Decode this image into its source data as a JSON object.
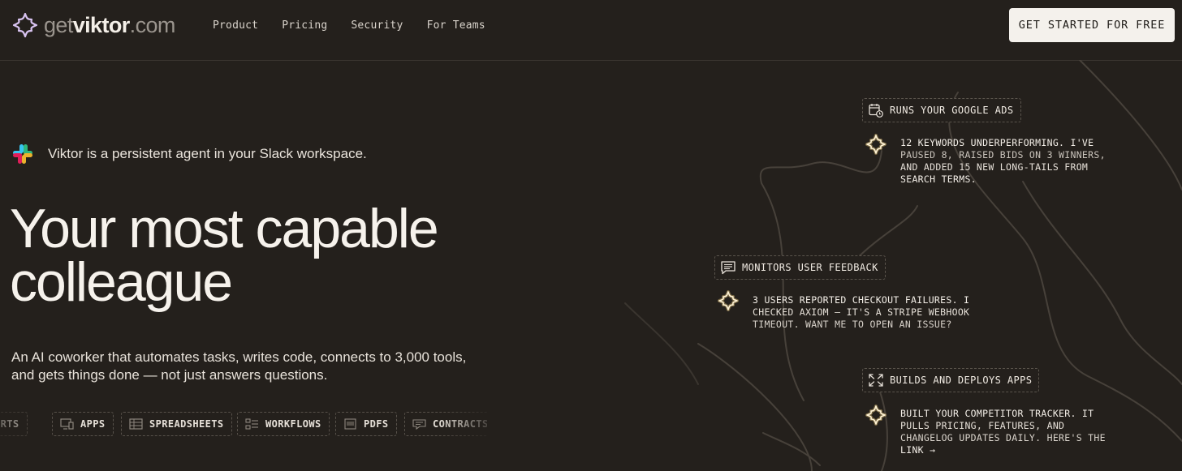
{
  "nav": {
    "logo_prefix": "get",
    "logo_name": "viktor",
    "logo_suffix": ".com",
    "links": [
      "Product",
      "Pricing",
      "Security",
      "For Teams"
    ],
    "cta": "GET STARTED FOR FREE"
  },
  "hero": {
    "slack_line": "Viktor is a persistent agent in your Slack workspace.",
    "headline_lines": [
      "Your most capable",
      "colleague"
    ],
    "sub_lines": [
      "An AI coworker that automates tasks, writes code, connects to 3,000 tools,",
      "and gets things done — not just answers questions."
    ],
    "chips": [
      "ORTS",
      "APPS",
      "SPREADSHEETS",
      "WORKFLOWS",
      "PDFS",
      "CONTRACTS"
    ]
  },
  "cards": [
    {
      "tag": "RUNS YOUR GOOGLE ADS",
      "icon": "calendar-clock-icon",
      "message_lines": [
        "12 KEYWORDS UNDERPERFORMING. I'VE",
        "PAUSED 8, RAISED BIDS ON 3 WINNERS,",
        "AND ADDED 15 NEW LONG-TAILS FROM",
        "SEARCH TERMS."
      ]
    },
    {
      "tag": "MONITORS USER FEEDBACK",
      "icon": "message-lines-icon",
      "message_lines": [
        "3 USERS REPORTED CHECKOUT FAILURES. I",
        "CHECKED AXIOM — IT'S A STRIPE WEBHOOK",
        "TIMEOUT. WANT ME TO OPEN AN ISSUE?"
      ]
    },
    {
      "tag": "BUILDS AND DEPLOYS APPS",
      "icon": "expand-arrows-icon",
      "message_lines": [
        "BUILT YOUR COMPETITOR TRACKER. IT",
        "PULLS PRICING, FEATURES, AND",
        "CHANGELOG UPDATES DAILY. HERE'S THE",
        "LINK →"
      ]
    }
  ],
  "colors": {
    "background": "#24201c",
    "text": "#f2ede6",
    "cta_bg": "#f4f1ec",
    "spark_glow": "#e8c77a"
  }
}
